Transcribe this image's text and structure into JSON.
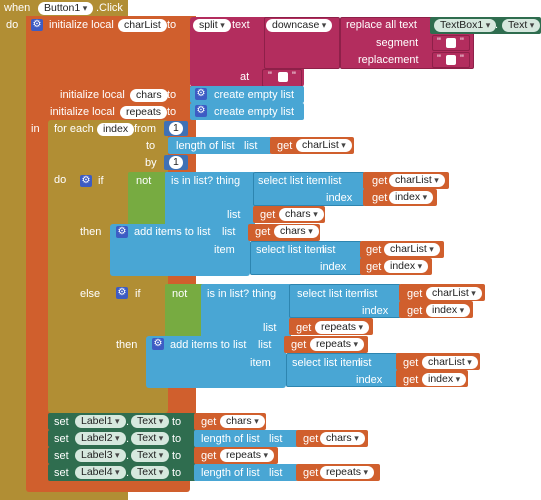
{
  "event": {
    "when": "when",
    "component": "Button1",
    "event": ".Click",
    "do": "do"
  },
  "init_charList": {
    "keyword": "initialize local",
    "name": "charList",
    "to": "to"
  },
  "split": {
    "op": "split",
    "text_label": "text",
    "at_label": "at",
    "at_value": " "
  },
  "downcase": {
    "op": "downcase"
  },
  "replace": {
    "op": "replace all text",
    "segment": "segment",
    "replacement": "replacement",
    "seg_value": " ",
    "rep_value": " "
  },
  "textbox": {
    "component": "TextBox1",
    "prop": "Text",
    "dot": "."
  },
  "init_chars": {
    "keyword": "initialize local",
    "name": "chars",
    "to": "to",
    "value": "create empty list"
  },
  "init_repeats": {
    "keyword": "initialize local",
    "name": "repeats",
    "to": "to",
    "value": "create empty list"
  },
  "in_label": "in",
  "foreach": {
    "keyword": "for each",
    "var": "index",
    "from": "from",
    "to": "to",
    "by": "by",
    "do": "do",
    "from_value": "1",
    "by_value": "1"
  },
  "length": {
    "op": "length of list",
    "list": "list",
    "get": "get",
    "var": "charList"
  },
  "if1": {
    "if": "if",
    "not": "not",
    "in_list": "is in list? thing",
    "list": "list",
    "select": "select list item",
    "select_list": "list",
    "select_index": "index",
    "get": "get",
    "v_charList": "charList",
    "v_index": "index",
    "v_chars": "chars",
    "then": "then",
    "else": "else"
  },
  "add1": {
    "op": "add items to list",
    "list": "list",
    "item": "item",
    "v_list": "chars",
    "select": "select list item",
    "select_list": "list",
    "select_index": "index",
    "v_charList": "charList",
    "v_index": "index",
    "get": "get"
  },
  "if2": {
    "if": "if",
    "not": "not",
    "in_list": "is in list? thing",
    "list": "list",
    "select": "select list item",
    "select_list": "list",
    "select_index": "index",
    "get": "get",
    "v_charList": "charList",
    "v_index": "index",
    "v_repeats": "repeats",
    "then": "then"
  },
  "add2": {
    "op": "add items to list",
    "list": "list",
    "item": "item",
    "v_list": "repeats",
    "select": "select list item",
    "select_list": "list",
    "select_index": "index",
    "v_charList": "charList",
    "v_index": "index",
    "get": "get"
  },
  "sets": [
    {
      "set": "set",
      "component": "Label1",
      "dot": ".",
      "prop": "Text",
      "to": "to",
      "get": "get",
      "value": "chars"
    },
    {
      "set": "set",
      "component": "Label2",
      "dot": ".",
      "prop": "Text",
      "to": "to",
      "op": "length of list",
      "list": "list",
      "get": "get",
      "value": "chars"
    },
    {
      "set": "set",
      "component": "Label3",
      "dot": ".",
      "prop": "Text",
      "to": "to",
      "get": "get",
      "value": "repeats"
    },
    {
      "set": "set",
      "component": "Label4",
      "dot": ".",
      "prop": "Text",
      "to": "to",
      "op": "length of list",
      "list": "list",
      "get": "get",
      "value": "repeats"
    }
  ],
  "colors": {
    "event": "#b18e34",
    "variable": "#d05f2d",
    "text": "#b32d5e",
    "list": "#49a6d4",
    "control": "#b18e34",
    "logic": "#77ab41",
    "math": "#3f71b5",
    "component": "#2f6d4f"
  }
}
